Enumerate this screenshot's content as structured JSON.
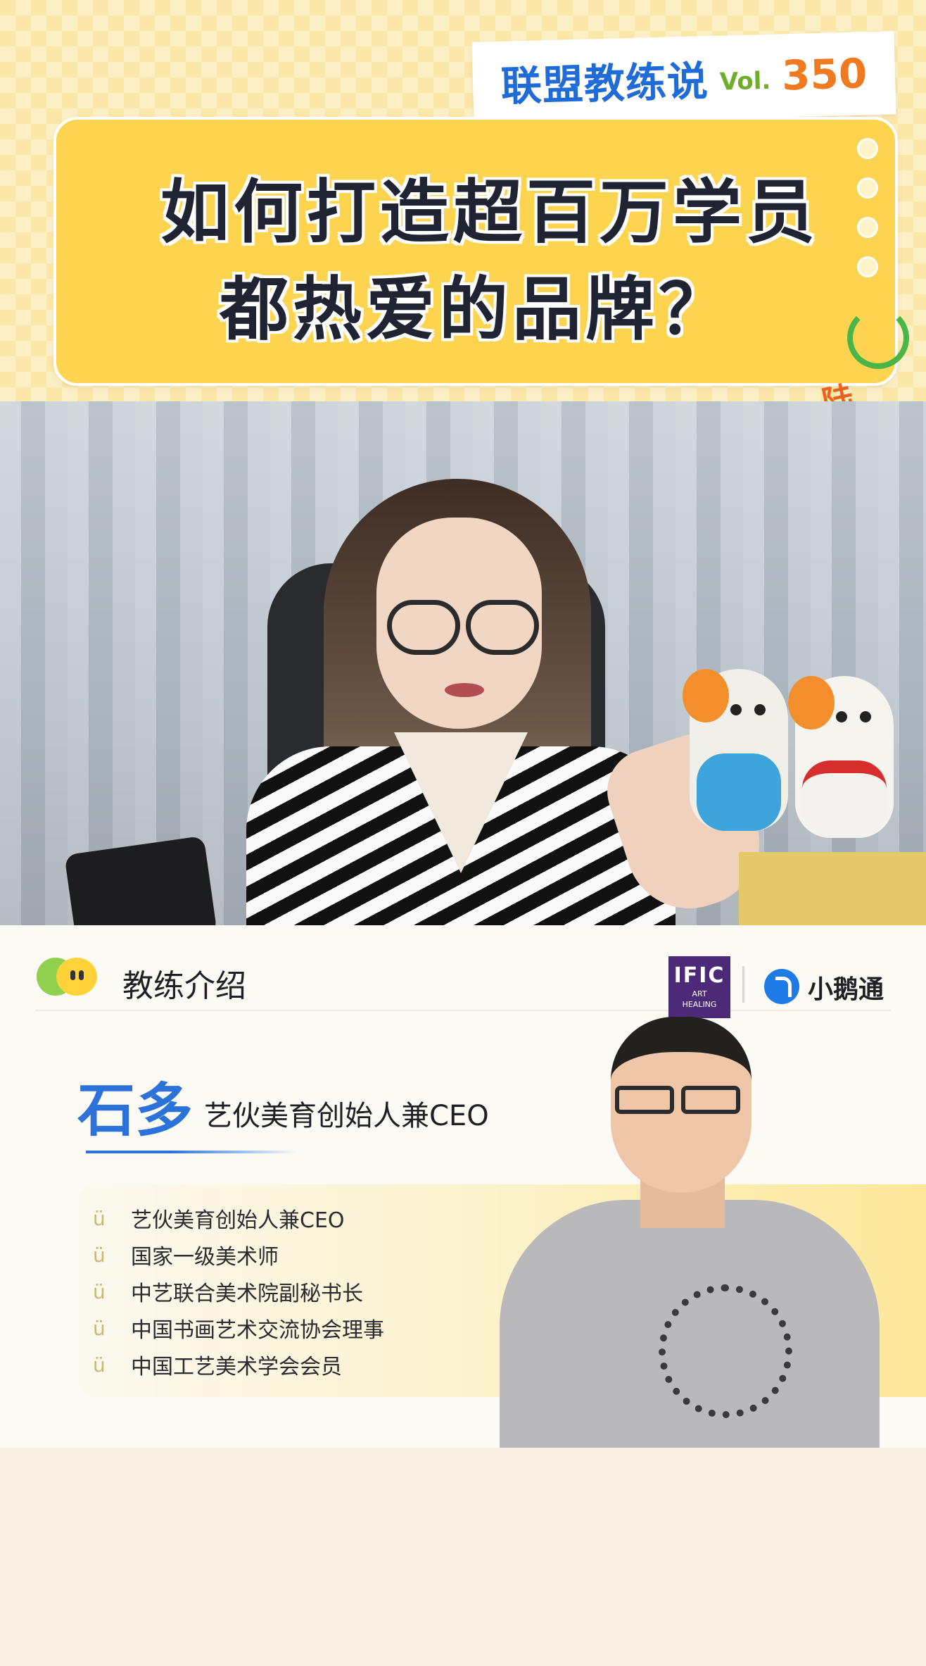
{
  "header": {
    "brand": "联盟教练说",
    "vol_label": "Vol.",
    "vol_number": "350",
    "title_line1": "如何打造超百万学员",
    "title_line2": "都热爱的品牌？",
    "corner_text": "陆"
  },
  "coach_panel": {
    "section_title": "教练介绍",
    "partner_logo_main": "IFIC",
    "partner_logo_sub1": "ART",
    "partner_logo_sub2": "HEALING",
    "platform_name": "小鹅通",
    "coach_name": "石多",
    "coach_role": "艺伙美育创始人兼CEO",
    "bullet_glyph": "ü",
    "credentials": [
      "艺伙美育创始人兼CEO",
      "国家一级美术师",
      "中艺联合美术院副秘书长",
      "中国书画艺术交流协会理事",
      "中国工艺美术学会会员"
    ]
  },
  "colors": {
    "brand_blue": "#1f6bd8",
    "vol_green": "#6fae2b",
    "vol_orange": "#f07a1f",
    "title_card_yellow": "#fdd44f",
    "name_blue": "#2c72d9"
  }
}
